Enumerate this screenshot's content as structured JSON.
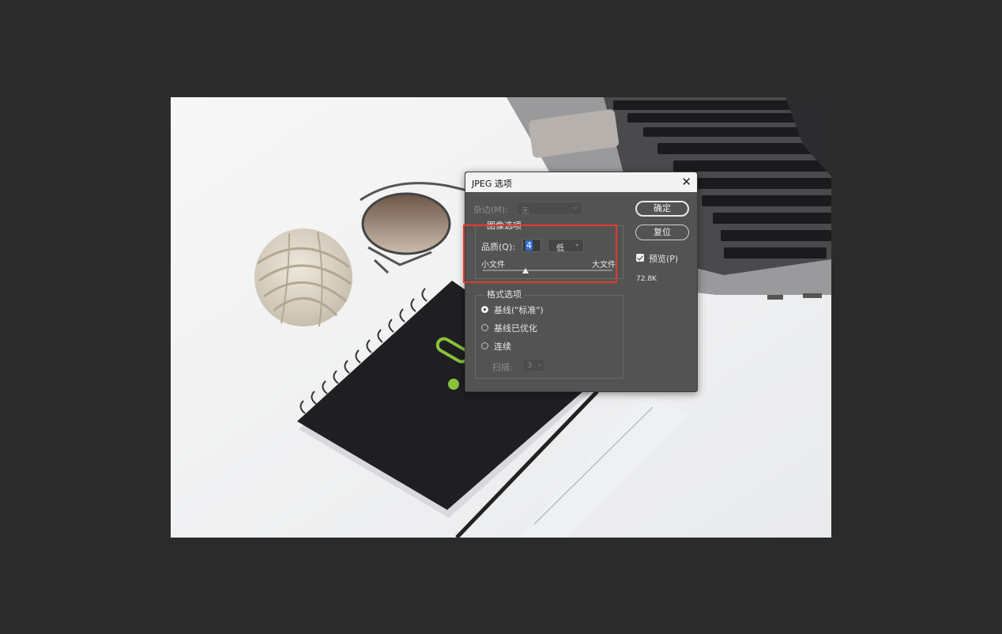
{
  "dialog": {
    "title": "JPEG 选项",
    "matte_label": "杂边(M):",
    "matte_value": "无",
    "image_options": {
      "title": "图像选项",
      "quality_label": "品质(Q):",
      "quality_value": "4",
      "quality_preset": "低",
      "small_file_label": "小文件",
      "large_file_label": "大文件",
      "slider_fraction": 0.33
    },
    "format_options": {
      "title": "格式选项",
      "options": [
        {
          "label": "基线(\"标准\")",
          "selected": true
        },
        {
          "label": "基线已优化",
          "selected": false
        },
        {
          "label": "连续",
          "selected": false
        }
      ],
      "scans_label": "扫描:",
      "scans_value": "3"
    },
    "ok_label": "确定",
    "reset_label": "复位",
    "preview_label": "预览(P)",
    "preview_checked": true,
    "file_size": "72.8K"
  },
  "icons": {
    "close": "close-icon",
    "chevron": "chevron-down-icon"
  },
  "colors": {
    "highlight": "#e03c2e",
    "dialog_bg": "#535353",
    "workspace_bg": "#2b2b2b"
  }
}
